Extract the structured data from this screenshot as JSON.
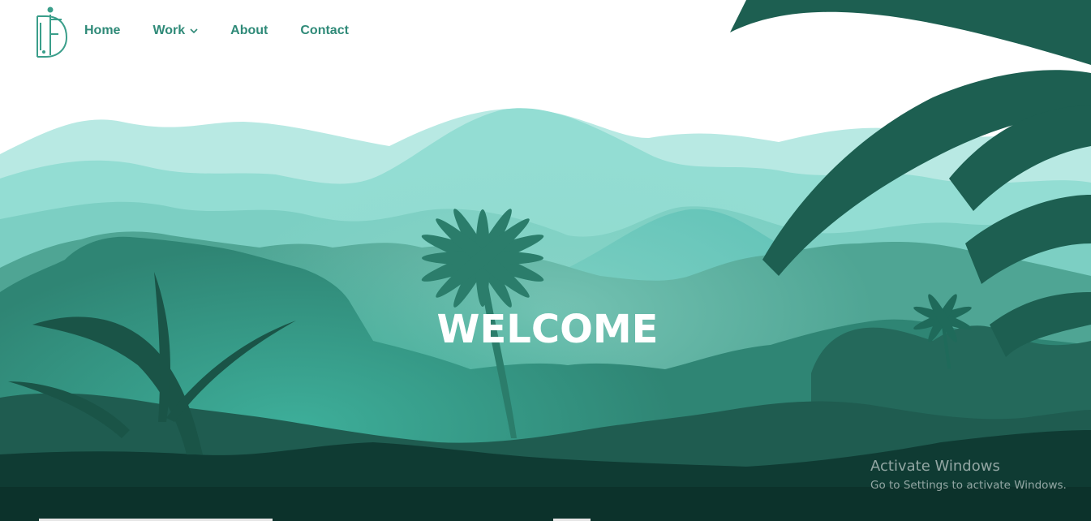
{
  "nav": {
    "logo_icon": "monogram-logo-icon",
    "items": [
      {
        "label": "Home",
        "has_dropdown": false
      },
      {
        "label": "Work",
        "has_dropdown": true,
        "dropdown_icon": "chevron-down-icon"
      },
      {
        "label": "About",
        "has_dropdown": false
      },
      {
        "label": "Contact",
        "has_dropdown": false
      }
    ]
  },
  "hero": {
    "title": "WELCOME",
    "illustration": "tropical-jungle-landscape",
    "colors": {
      "sky": "#ffffff",
      "far_hills": "#b5e8e2",
      "mid_hills": "#8fdcd1",
      "near_hills": "#5fb7a7",
      "forest": "#2f8a77",
      "dark_foliage": "#1c5e50",
      "ground": "#0f3b33",
      "accent": "#2f8a78"
    }
  },
  "os_watermark": {
    "title": "Activate Windows",
    "subtitle": "Go to Settings to activate Windows."
  }
}
